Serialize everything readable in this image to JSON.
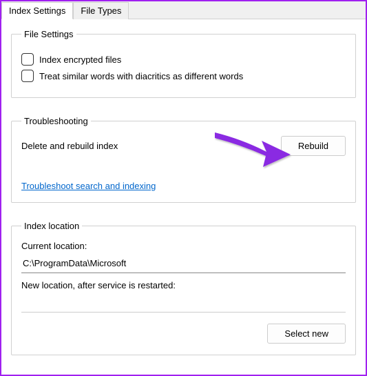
{
  "tabs": {
    "index_settings": "Index Settings",
    "file_types": "File Types"
  },
  "file_settings": {
    "legend": "File Settings",
    "encrypt_label": "Index encrypted files",
    "diacritics_label": "Treat similar words with diacritics as different words"
  },
  "troubleshooting": {
    "legend": "Troubleshooting",
    "delete_rebuild_label": "Delete and rebuild index",
    "rebuild_button": "Rebuild",
    "troubleshoot_link": "Troubleshoot search and indexing"
  },
  "index_location": {
    "legend": "Index location",
    "current_label": "Current location:",
    "current_value": "C:\\ProgramData\\Microsoft",
    "new_label": "New location, after service is restarted:",
    "new_value": "",
    "select_new_button": "Select new"
  },
  "annotation": {
    "arrow_color": "#8a2be2"
  }
}
